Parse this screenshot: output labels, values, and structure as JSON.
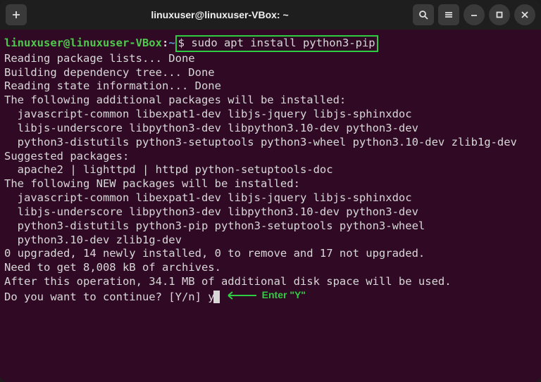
{
  "titlebar": {
    "title": "linuxuser@linuxuser-VBox: ~"
  },
  "prompt": {
    "user_host": "linuxuser@linuxuser-VBox",
    "path": "~",
    "command": "$ sudo apt install python3-pip"
  },
  "output": {
    "line1": "Reading package lists... Done",
    "line2": "Building dependency tree... Done",
    "line3": "Reading state information... Done",
    "line4": "The following additional packages will be installed:",
    "line5": "  javascript-common libexpat1-dev libjs-jquery libjs-sphinxdoc",
    "line6": "  libjs-underscore libpython3-dev libpython3.10-dev python3-dev",
    "line7": "  python3-distutils python3-setuptools python3-wheel python3.10-dev zlib1g-dev",
    "line8": "Suggested packages:",
    "line9": "  apache2 | lighttpd | httpd python-setuptools-doc",
    "line10": "The following NEW packages will be installed:",
    "line11": "  javascript-common libexpat1-dev libjs-jquery libjs-sphinxdoc",
    "line12": "  libjs-underscore libpython3-dev libpython3.10-dev python3-dev",
    "line13": "  python3-distutils python3-pip python3-setuptools python3-wheel",
    "line14": "  python3.10-dev zlib1g-dev",
    "line15": "0 upgraded, 14 newly installed, 0 to remove and 17 not upgraded.",
    "line16": "Need to get 8,008 kB of archives.",
    "line17": "After this operation, 34.1 MB of additional disk space will be used.",
    "line18": "Do you want to continue? [Y/n] ",
    "input_response": "y"
  },
  "annotation": {
    "text": "Enter \"Y\""
  }
}
